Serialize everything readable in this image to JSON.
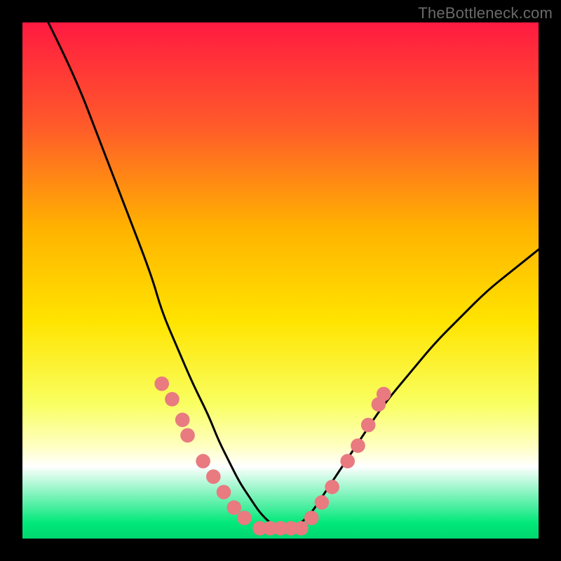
{
  "watermark": "TheBottleneck.com",
  "chart_data": {
    "type": "line",
    "title": "",
    "xlabel": "",
    "ylabel": "",
    "xlim": [
      0,
      100
    ],
    "ylim": [
      0,
      100
    ],
    "grid": false,
    "legend": false,
    "gradient_stops": [
      {
        "offset": 0.0,
        "color": "#ff1a41"
      },
      {
        "offset": 0.2,
        "color": "#ff5a2a"
      },
      {
        "offset": 0.4,
        "color": "#ffb300"
      },
      {
        "offset": 0.58,
        "color": "#ffe400"
      },
      {
        "offset": 0.74,
        "color": "#f9ff62"
      },
      {
        "offset": 0.82,
        "color": "#ffffc0"
      },
      {
        "offset": 0.86,
        "color": "#ffffff"
      },
      {
        "offset": 0.97,
        "color": "#00e879"
      },
      {
        "offset": 1.0,
        "color": "#00d870"
      }
    ],
    "series": [
      {
        "name": "bottleneck-curve",
        "color": "#000000",
        "x": [
          5,
          10,
          15,
          20,
          25,
          27,
          30,
          33,
          36,
          38,
          40,
          42,
          44,
          46,
          48,
          50,
          52,
          54,
          56,
          58,
          62,
          66,
          70,
          75,
          80,
          85,
          90,
          95,
          100
        ],
        "y": [
          100,
          90,
          77,
          64,
          51,
          44,
          37,
          30,
          24,
          19,
          15,
          11,
          8,
          5,
          3,
          2,
          2,
          3,
          5,
          8,
          14,
          20,
          26,
          32,
          38,
          43,
          48,
          52,
          56
        ]
      }
    ],
    "markers": {
      "name": "highlighted-points",
      "color": "#e87a80",
      "radius_pct": 1.4,
      "points": [
        {
          "x": 27,
          "y": 30
        },
        {
          "x": 29,
          "y": 27
        },
        {
          "x": 31,
          "y": 23
        },
        {
          "x": 32,
          "y": 20
        },
        {
          "x": 35,
          "y": 15
        },
        {
          "x": 37,
          "y": 12
        },
        {
          "x": 39,
          "y": 9
        },
        {
          "x": 41,
          "y": 6
        },
        {
          "x": 43,
          "y": 4
        },
        {
          "x": 46,
          "y": 2
        },
        {
          "x": 48,
          "y": 2
        },
        {
          "x": 50,
          "y": 2
        },
        {
          "x": 52,
          "y": 2
        },
        {
          "x": 54,
          "y": 2
        },
        {
          "x": 56,
          "y": 4
        },
        {
          "x": 58,
          "y": 7
        },
        {
          "x": 60,
          "y": 10
        },
        {
          "x": 63,
          "y": 15
        },
        {
          "x": 65,
          "y": 18
        },
        {
          "x": 67,
          "y": 22
        },
        {
          "x": 69,
          "y": 26
        },
        {
          "x": 70,
          "y": 28
        }
      ]
    }
  }
}
